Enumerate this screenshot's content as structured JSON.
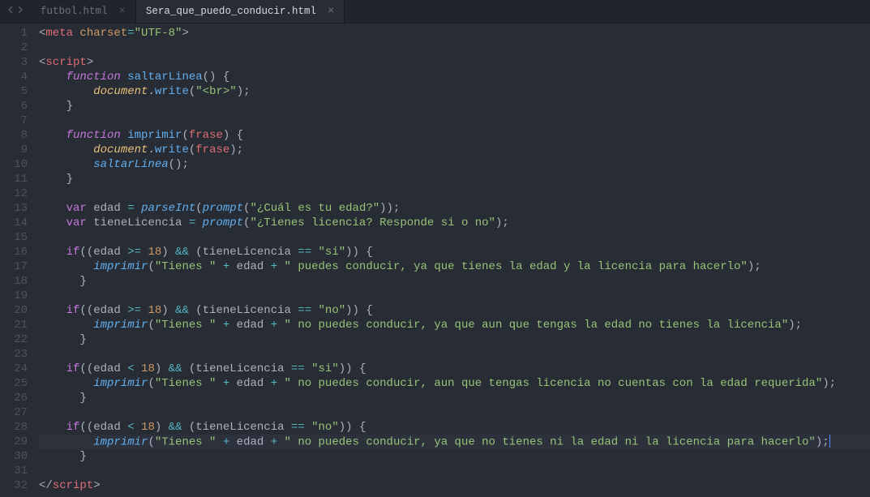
{
  "tabs": [
    {
      "label": "futbol.html",
      "active": false
    },
    {
      "label": "Sera_que_puedo_conducir.html",
      "active": true
    }
  ],
  "lineCount": 32,
  "highlightLine": 29,
  "code": {
    "L1": [
      [
        "punct",
        "<"
      ],
      [
        "tag",
        "meta"
      ],
      [
        "plain",
        " "
      ],
      [
        "attr",
        "charset"
      ],
      [
        "op",
        "="
      ],
      [
        "str",
        "\"UTF-8\""
      ],
      [
        "punct",
        ">"
      ]
    ],
    "L2": [],
    "L3": [
      [
        "punct",
        "<"
      ],
      [
        "tag",
        "script"
      ],
      [
        "punct",
        ">"
      ]
    ],
    "L4": [
      [
        "plain",
        "    "
      ],
      [
        "kw",
        "function"
      ],
      [
        "plain",
        " "
      ],
      [
        "func",
        "saltarLinea"
      ],
      [
        "punct",
        "() {"
      ]
    ],
    "L5": [
      [
        "plain",
        "        "
      ],
      [
        "var",
        "document"
      ],
      [
        "punct",
        "."
      ],
      [
        "func",
        "write"
      ],
      [
        "punct",
        "("
      ],
      [
        "str",
        "\"<br>\""
      ],
      [
        "punct",
        ");"
      ]
    ],
    "L6": [
      [
        "plain",
        "    "
      ],
      [
        "punct",
        "}"
      ]
    ],
    "L7": [],
    "L8": [
      [
        "plain",
        "    "
      ],
      [
        "kw",
        "function"
      ],
      [
        "plain",
        " "
      ],
      [
        "func",
        "imprimir"
      ],
      [
        "punct",
        "("
      ],
      [
        "name",
        "frase"
      ],
      [
        "punct",
        ") {"
      ]
    ],
    "L9": [
      [
        "plain",
        "        "
      ],
      [
        "var",
        "document"
      ],
      [
        "punct",
        "."
      ],
      [
        "func",
        "write"
      ],
      [
        "punct",
        "("
      ],
      [
        "name",
        "frase"
      ],
      [
        "punct",
        ");"
      ]
    ],
    "L10": [
      [
        "plain",
        "        "
      ],
      [
        "funcit",
        "saltarLinea"
      ],
      [
        "punct",
        "();"
      ]
    ],
    "L11": [
      [
        "plain",
        "    "
      ],
      [
        "punct",
        "}"
      ]
    ],
    "L12": [],
    "L13": [
      [
        "plain",
        "    "
      ],
      [
        "kwn",
        "var"
      ],
      [
        "plain",
        " edad "
      ],
      [
        "op",
        "="
      ],
      [
        "plain",
        " "
      ],
      [
        "funcit",
        "parseInt"
      ],
      [
        "punct",
        "("
      ],
      [
        "funcit",
        "prompt"
      ],
      [
        "punct",
        "("
      ],
      [
        "str",
        "\"¿Cuál es tu edad?\""
      ],
      [
        "punct",
        "));"
      ]
    ],
    "L14": [
      [
        "plain",
        "    "
      ],
      [
        "kwn",
        "var"
      ],
      [
        "plain",
        " tieneLicencia "
      ],
      [
        "op",
        "="
      ],
      [
        "plain",
        " "
      ],
      [
        "funcit",
        "prompt"
      ],
      [
        "punct",
        "("
      ],
      [
        "str",
        "\"¿Tienes licencia? Responde si o no\""
      ],
      [
        "punct",
        ");"
      ]
    ],
    "L15": [],
    "L16": [
      [
        "plain",
        "    "
      ],
      [
        "kwn",
        "if"
      ],
      [
        "punct",
        "((edad "
      ],
      [
        "op",
        ">="
      ],
      [
        "plain",
        " "
      ],
      [
        "num",
        "18"
      ],
      [
        "punct",
        ") "
      ],
      [
        "op",
        "&&"
      ],
      [
        "punct",
        " (tieneLicencia "
      ],
      [
        "op",
        "=="
      ],
      [
        "plain",
        " "
      ],
      [
        "str",
        "\"si\""
      ],
      [
        "punct",
        ")) {"
      ]
    ],
    "L17": [
      [
        "plain",
        "        "
      ],
      [
        "funcit",
        "imprimir"
      ],
      [
        "punct",
        "("
      ],
      [
        "str",
        "\"Tienes \""
      ],
      [
        "plain",
        " "
      ],
      [
        "op",
        "+"
      ],
      [
        "plain",
        " edad "
      ],
      [
        "op",
        "+"
      ],
      [
        "plain",
        " "
      ],
      [
        "str",
        "\" puedes conducir, ya que tienes la edad y la licencia para hacerlo\""
      ],
      [
        "punct",
        ");"
      ]
    ],
    "L18": [
      [
        "plain",
        "      "
      ],
      [
        "punct",
        "}"
      ]
    ],
    "L19": [],
    "L20": [
      [
        "plain",
        "    "
      ],
      [
        "kwn",
        "if"
      ],
      [
        "punct",
        "((edad "
      ],
      [
        "op",
        ">="
      ],
      [
        "plain",
        " "
      ],
      [
        "num",
        "18"
      ],
      [
        "punct",
        ") "
      ],
      [
        "op",
        "&&"
      ],
      [
        "punct",
        " (tieneLicencia "
      ],
      [
        "op",
        "=="
      ],
      [
        "plain",
        " "
      ],
      [
        "str",
        "\"no\""
      ],
      [
        "punct",
        ")) {"
      ]
    ],
    "L21": [
      [
        "plain",
        "        "
      ],
      [
        "funcit",
        "imprimir"
      ],
      [
        "punct",
        "("
      ],
      [
        "str",
        "\"Tienes \""
      ],
      [
        "plain",
        " "
      ],
      [
        "op",
        "+"
      ],
      [
        "plain",
        " edad "
      ],
      [
        "op",
        "+"
      ],
      [
        "plain",
        " "
      ],
      [
        "str",
        "\" no puedes conducir, ya que aun que tengas la edad no tienes la licencia\""
      ],
      [
        "punct",
        ");"
      ]
    ],
    "L22": [
      [
        "plain",
        "      "
      ],
      [
        "punct",
        "}"
      ]
    ],
    "L23": [],
    "L24": [
      [
        "plain",
        "    "
      ],
      [
        "kwn",
        "if"
      ],
      [
        "punct",
        "((edad "
      ],
      [
        "op",
        "<"
      ],
      [
        "plain",
        " "
      ],
      [
        "num",
        "18"
      ],
      [
        "punct",
        ") "
      ],
      [
        "op",
        "&&"
      ],
      [
        "punct",
        " (tieneLicencia "
      ],
      [
        "op",
        "=="
      ],
      [
        "plain",
        " "
      ],
      [
        "str",
        "\"si\""
      ],
      [
        "punct",
        ")) {"
      ]
    ],
    "L25": [
      [
        "plain",
        "        "
      ],
      [
        "funcit",
        "imprimir"
      ],
      [
        "punct",
        "("
      ],
      [
        "str",
        "\"Tienes \""
      ],
      [
        "plain",
        " "
      ],
      [
        "op",
        "+"
      ],
      [
        "plain",
        " edad "
      ],
      [
        "op",
        "+"
      ],
      [
        "plain",
        " "
      ],
      [
        "str",
        "\" no puedes conducir, aun que tengas licencia no cuentas con la edad requerida\""
      ],
      [
        "punct",
        ");"
      ]
    ],
    "L26": [
      [
        "plain",
        "      "
      ],
      [
        "punct",
        "}"
      ]
    ],
    "L27": [],
    "L28": [
      [
        "plain",
        "    "
      ],
      [
        "kwn",
        "if"
      ],
      [
        "punct",
        "((edad "
      ],
      [
        "op",
        "<"
      ],
      [
        "plain",
        " "
      ],
      [
        "num",
        "18"
      ],
      [
        "punct",
        ") "
      ],
      [
        "op",
        "&&"
      ],
      [
        "punct",
        " (tieneLicencia "
      ],
      [
        "op",
        "=="
      ],
      [
        "plain",
        " "
      ],
      [
        "str",
        "\"no\""
      ],
      [
        "punct",
        ")) {"
      ]
    ],
    "L29": [
      [
        "plain",
        "        "
      ],
      [
        "funcit",
        "imprimir"
      ],
      [
        "punct",
        "("
      ],
      [
        "str",
        "\"Tienes \""
      ],
      [
        "plain",
        " "
      ],
      [
        "op",
        "+"
      ],
      [
        "plain",
        " edad "
      ],
      [
        "op",
        "+"
      ],
      [
        "plain",
        " "
      ],
      [
        "str",
        "\" no puedes conducir, ya que no tienes ni la edad ni la licencia para hacerlo\""
      ],
      [
        "punct",
        ");"
      ]
    ],
    "L30": [
      [
        "plain",
        "      "
      ],
      [
        "punct",
        "}"
      ]
    ],
    "L31": [],
    "L32": [
      [
        "punct",
        "</"
      ],
      [
        "tag",
        "script"
      ],
      [
        "punct",
        ">"
      ]
    ]
  }
}
